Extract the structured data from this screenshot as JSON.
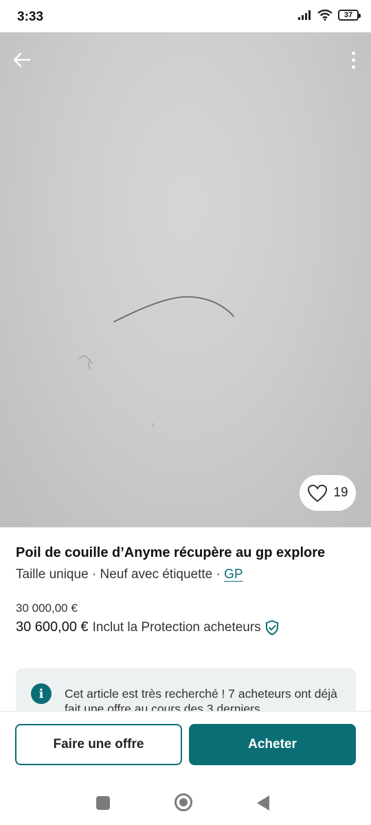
{
  "status_bar": {
    "time": "3:33",
    "battery_level": "37",
    "icons": [
      "signal-icon",
      "wifi-icon",
      "battery-icon"
    ]
  },
  "photo": {
    "favorites_count": "19",
    "icons": [
      "back-arrow-icon",
      "more-vert-icon",
      "heart-icon"
    ]
  },
  "item": {
    "title": "Poil de couille d’Anyme récupère au gp explore",
    "size": "Taille unique",
    "separator": " · ",
    "condition": "Neuf avec étiquette",
    "brand": "GP",
    "price": "30 000,00 €",
    "price_total": "30 600,00 €",
    "protection_label": "Inclut la Protection acheteurs"
  },
  "info": {
    "text": "Cet article est très recherché ! 7 acheteurs ont déjà fait une offre au cours des 3 derniers"
  },
  "actions": {
    "offer_label": "Faire une offre",
    "buy_label": "Acheter"
  },
  "colors": {
    "accent": "#0b6e75",
    "info_bg": "#eef1f1",
    "photo_bg": "#cdcdcd"
  }
}
